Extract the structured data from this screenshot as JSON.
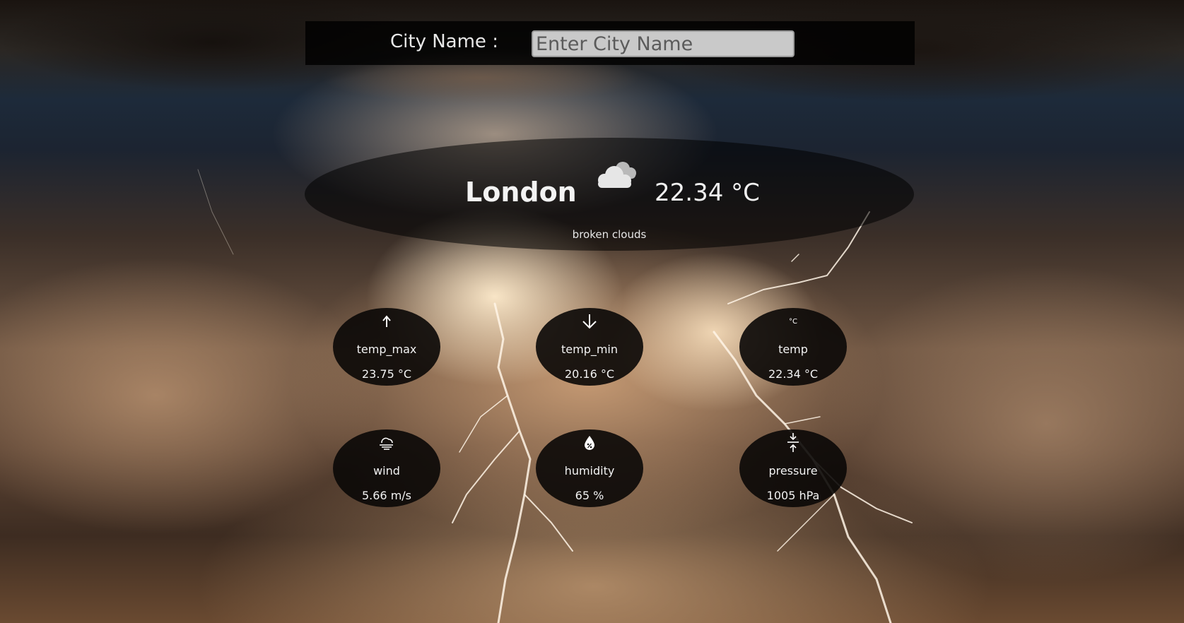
{
  "search": {
    "label": "City Name :",
    "placeholder": "Enter City Name",
    "value": ""
  },
  "current": {
    "city": "London",
    "temperature": "22.34 °C",
    "description": "broken clouds",
    "icon": "broken-clouds-icon"
  },
  "stats": [
    {
      "icon": "arrow-up-icon",
      "label": "temp_max",
      "value": "23.75 °C"
    },
    {
      "icon": "arrow-down-icon",
      "label": "temp_min",
      "value": "20.16 °C"
    },
    {
      "icon": "celsius-icon",
      "label": "temp",
      "value": "22.34 °C",
      "icon_text": "°C"
    },
    {
      "icon": "wind-icon",
      "label": "wind",
      "value": "5.66 m/s"
    },
    {
      "icon": "humidity-drop-icon",
      "label": "humidity",
      "value": "65 %"
    },
    {
      "icon": "pressure-icon",
      "label": "pressure",
      "value": "1005 hPa"
    }
  ],
  "colors": {
    "overlay": "#000000",
    "text": "#f2f2f2",
    "input_background": "#c9c9c9"
  }
}
